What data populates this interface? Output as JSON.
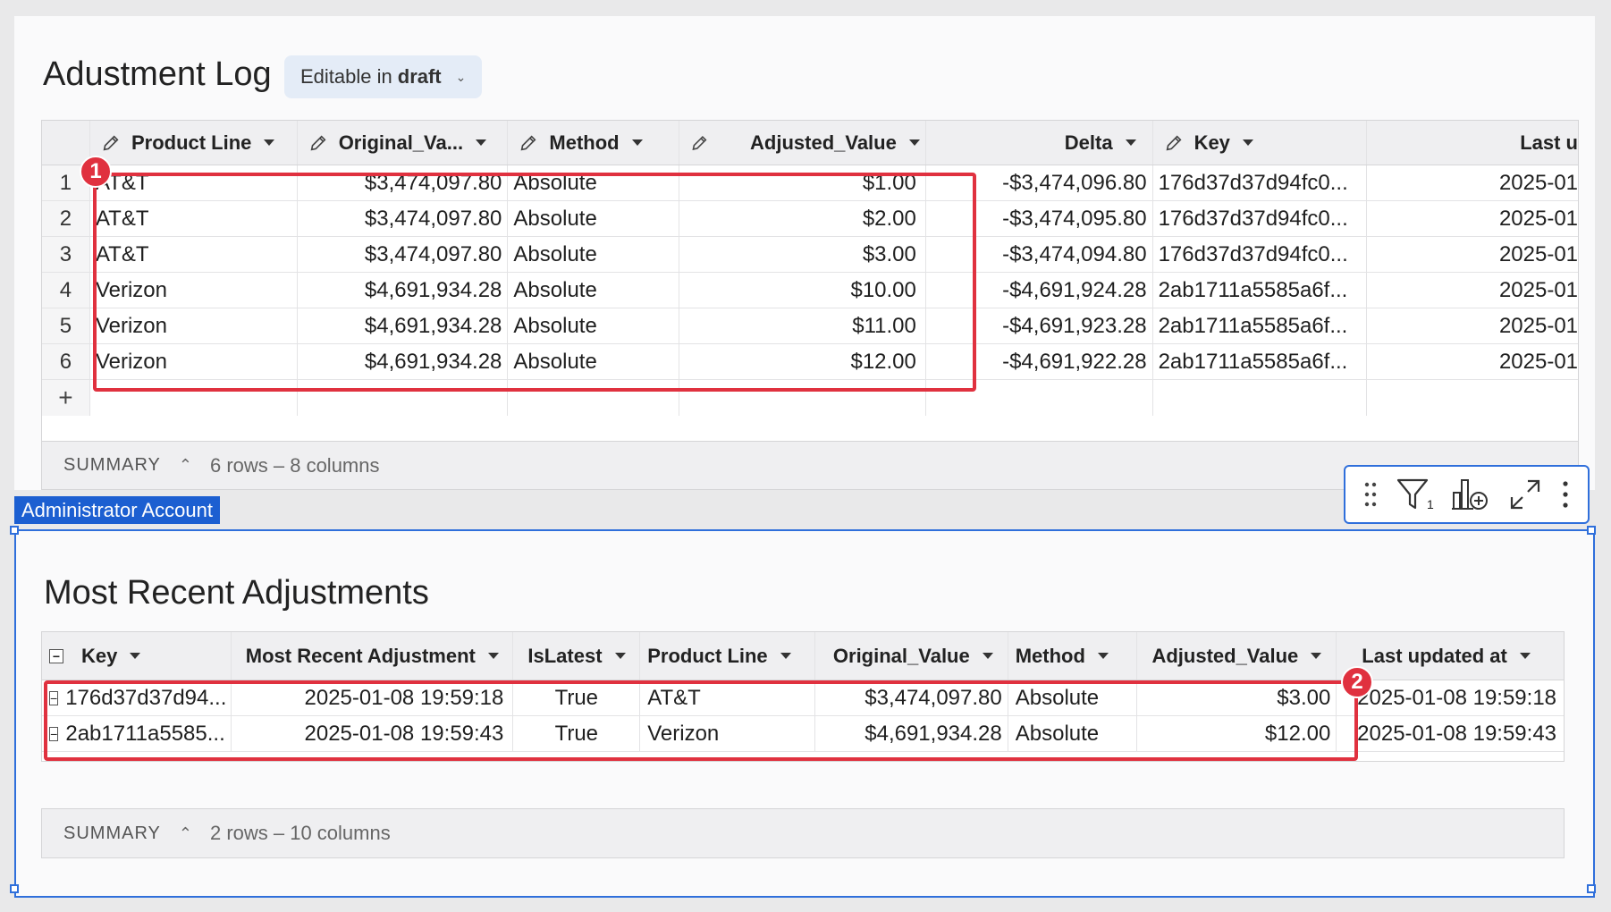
{
  "top": {
    "title": "Adustment Log",
    "edit_pill": {
      "prefix": "Editable in",
      "mode": "draft"
    },
    "columns": [
      "Product Line",
      "Original_Va...",
      "Method",
      "Adjusted_Value",
      "Delta",
      "Key",
      "Last u"
    ],
    "rows": [
      {
        "n": "1",
        "product": "AT&T",
        "original": "$3,474,097.80",
        "method": "Absolute",
        "adjusted": "$1.00",
        "delta": "-$3,474,096.80",
        "key": "176d37d37d94fc0...",
        "last": "2025-01"
      },
      {
        "n": "2",
        "product": "AT&T",
        "original": "$3,474,097.80",
        "method": "Absolute",
        "adjusted": "$2.00",
        "delta": "-$3,474,095.80",
        "key": "176d37d37d94fc0...",
        "last": "2025-01"
      },
      {
        "n": "3",
        "product": "AT&T",
        "original": "$3,474,097.80",
        "method": "Absolute",
        "adjusted": "$3.00",
        "delta": "-$3,474,094.80",
        "key": "176d37d37d94fc0...",
        "last": "2025-01"
      },
      {
        "n": "4",
        "product": "Verizon",
        "original": "$4,691,934.28",
        "method": "Absolute",
        "adjusted": "$10.00",
        "delta": "-$4,691,924.28",
        "key": "2ab1711a5585a6f...",
        "last": "2025-01"
      },
      {
        "n": "5",
        "product": "Verizon",
        "original": "$4,691,934.28",
        "method": "Absolute",
        "adjusted": "$11.00",
        "delta": "-$4,691,923.28",
        "key": "2ab1711a5585a6f...",
        "last": "2025-01"
      },
      {
        "n": "6",
        "product": "Verizon",
        "original": "$4,691,934.28",
        "method": "Absolute",
        "adjusted": "$12.00",
        "delta": "-$4,691,922.28",
        "key": "2ab1711a5585a6f...",
        "last": "2025-01"
      }
    ],
    "add_row": "+",
    "summary": {
      "label": "SUMMARY",
      "text": "6 rows – 8 columns"
    },
    "badge": "1"
  },
  "admin_tag": "Administrator Account",
  "toolbar": {
    "filter_count": "1"
  },
  "bottom": {
    "title": "Most Recent Adjustments",
    "columns": [
      "Key",
      "Most Recent Adjustment",
      "IsLatest",
      "Product Line",
      "Original_Value",
      "Method",
      "Adjusted_Value",
      "Last updated at"
    ],
    "rows": [
      {
        "key": "176d37d37d94...",
        "recent": "2025-01-08 19:59:18",
        "latest": "True",
        "product": "AT&T",
        "original": "$3,474,097.80",
        "method": "Absolute",
        "adjusted": "$3.00",
        "updated": "2025-01-08 19:59:18"
      },
      {
        "key": "2ab1711a5585...",
        "recent": "2025-01-08 19:59:43",
        "latest": "True",
        "product": "Verizon",
        "original": "$4,691,934.28",
        "method": "Absolute",
        "adjusted": "$12.00",
        "updated": "2025-01-08 19:59:43"
      }
    ],
    "summary": {
      "label": "SUMMARY",
      "text": "2 rows – 10 columns"
    },
    "badge": "2"
  },
  "colors": {
    "highlight": "#e0313f",
    "selection": "#2f6fdb",
    "admin_tag": "#1c5fd1"
  }
}
